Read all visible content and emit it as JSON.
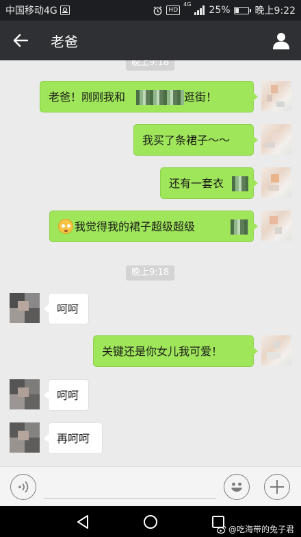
{
  "status_bar": {
    "carrier": "中国移动4G",
    "hd_badge": "HD",
    "network": "4G",
    "battery_percent": "25%",
    "battery_level": 0.25,
    "time": "晚上9:22"
  },
  "header": {
    "back_icon": "back-arrow-icon",
    "title": "老爸",
    "profile_icon": "person-icon"
  },
  "chat": {
    "timestamp_top": "晚上9:18",
    "messages": [
      {
        "side": "right",
        "text_before": "老爸！刚刚我和",
        "text_after": "了逛街！"
      },
      {
        "side": "right",
        "text": "我买了条裙子～～"
      },
      {
        "side": "right",
        "text": "还有一套衣"
      },
      {
        "side": "right",
        "emoji": "flushed-face-emoji",
        "text": "我觉得我的裙子超级超级"
      },
      {
        "side": "left",
        "text": "呵呵"
      },
      {
        "side": "right",
        "text": "关键还是你女儿我可爱！"
      },
      {
        "side": "left",
        "text": "呵呵"
      },
      {
        "side": "left",
        "text": "再呵呵"
      }
    ],
    "timestamp_mid": "晚上9:18"
  },
  "input_bar": {
    "voice_icon": "voice-icon",
    "text_value": "",
    "emoji_icon": "smiley-icon",
    "plus_icon": "plus-icon"
  },
  "system_nav": {
    "back_icon": "triangle-back-icon",
    "home_icon": "circle-home-icon",
    "recent_icon": "square-recent-icon"
  },
  "watermark": "@吃海带的兔子君",
  "colors": {
    "status_bg": "#1d1e22",
    "header_bg": "#2e3033",
    "chat_bg": "#ebebeb",
    "bubble_green": "#9fe65a",
    "bubble_white": "#ffffff"
  }
}
